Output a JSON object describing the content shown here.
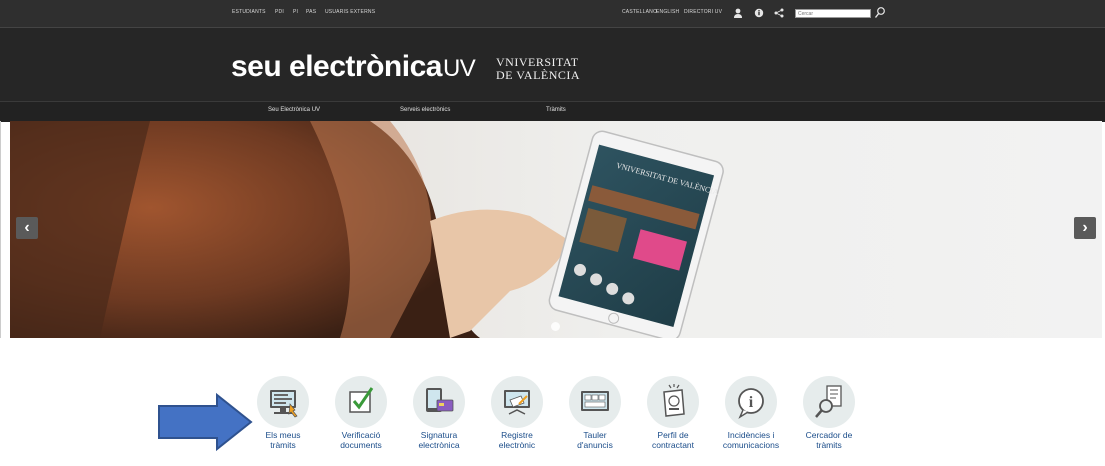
{
  "topbar": {
    "left_links": [
      "ESTUDIANTS",
      "PDI",
      "PI",
      "PAS",
      "USUARIS EXTERNS"
    ],
    "right_links": [
      "CASTELLANO",
      "ENGLISH",
      "DIRECTORI UV"
    ],
    "search": {
      "placeholder": "Cercar"
    }
  },
  "header": {
    "logo_main": "seu electrònica",
    "logo_suffix": "UV",
    "university_line1": "VNIVERSITAT",
    "university_line2": "DE VALÈNCIA"
  },
  "nav": [
    "Seu Electrònica UV",
    "Serveis electrònics",
    "Tràmits"
  ],
  "carousel": {
    "prev_icon": "‹",
    "next_icon": "›",
    "tablet_brand": "VNIVERSITAT DE VALÈNCIA"
  },
  "services": [
    {
      "label1": "Els meus",
      "label2": "tràmits",
      "icon": "computer-icon"
    },
    {
      "label1": "Verificació",
      "label2": "documents",
      "icon": "checkbox-icon"
    },
    {
      "label1": "Signatura",
      "label2": "electrònica",
      "icon": "card-sign-icon"
    },
    {
      "label1": "Registre",
      "label2": "electrònic",
      "icon": "register-icon"
    },
    {
      "label1": "Tauler",
      "label2": "d'anuncis",
      "icon": "board-icon"
    },
    {
      "label1": "Perfil de",
      "label2": "contractant",
      "icon": "profile-icon"
    },
    {
      "label1": "Incidències i",
      "label2": "comunicacions",
      "icon": "info-icon"
    },
    {
      "label1": "Cercador de",
      "label2": "tràmits",
      "icon": "magnifier-doc-icon"
    }
  ],
  "colors": {
    "topbar": "#2f2f2f",
    "header": "#262626",
    "link": "#1b4d8a",
    "tile_bg": "#e6ecec",
    "guide_arrow": "#4472c4"
  }
}
